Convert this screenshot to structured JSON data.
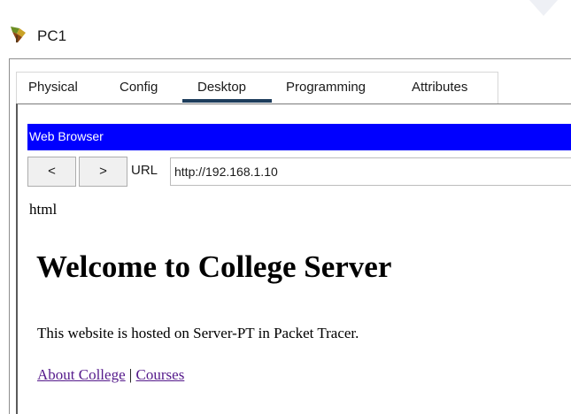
{
  "window": {
    "title": "PC1",
    "icon": "packet-tracer-pc-icon"
  },
  "tabs": [
    {
      "label": "Physical",
      "active": false
    },
    {
      "label": "Config",
      "active": false
    },
    {
      "label": "Desktop",
      "active": true
    },
    {
      "label": "Programming",
      "active": false
    },
    {
      "label": "Attributes",
      "active": false
    }
  ],
  "browser": {
    "title": "Web Browser",
    "back_label": "<",
    "forward_label": ">",
    "url_label": "URL",
    "url_value": "http://192.168.1.10"
  },
  "page": {
    "pre_text": "html",
    "heading": "Welcome to College Server",
    "paragraph": "This website is hosted on Server-PT in Packet Tracer.",
    "links": [
      {
        "label": "About College"
      },
      {
        "label": "Courses"
      }
    ],
    "link_separator": " | "
  },
  "colors": {
    "browser_titlebar": "#0000ff",
    "active_tab_indicator": "#1e3d5c",
    "visited_link": "#551a8b"
  }
}
